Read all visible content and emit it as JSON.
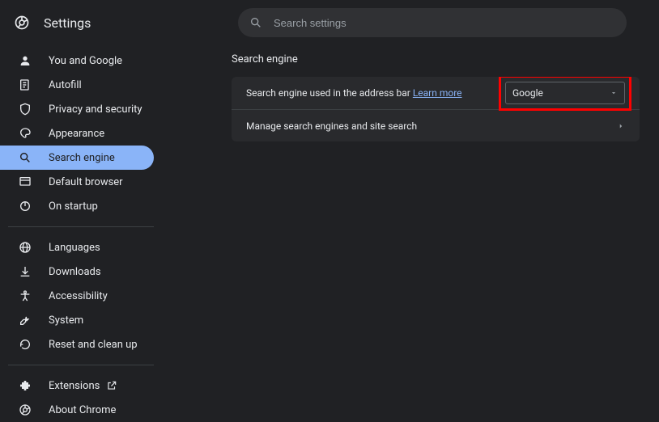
{
  "header": {
    "title": "Settings",
    "search_placeholder": "Search settings"
  },
  "sidebar": {
    "items": [
      {
        "label": "You and Google",
        "icon": "user-icon"
      },
      {
        "label": "Autofill",
        "icon": "autofill-icon"
      },
      {
        "label": "Privacy and security",
        "icon": "shield-icon"
      },
      {
        "label": "Appearance",
        "icon": "appearance-icon"
      },
      {
        "label": "Search engine",
        "icon": "search-icon",
        "active": true
      },
      {
        "label": "Default browser",
        "icon": "browser-icon"
      },
      {
        "label": "On startup",
        "icon": "power-icon"
      }
    ],
    "items2": [
      {
        "label": "Languages",
        "icon": "globe-icon"
      },
      {
        "label": "Downloads",
        "icon": "download-icon"
      },
      {
        "label": "Accessibility",
        "icon": "accessibility-icon"
      },
      {
        "label": "System",
        "icon": "wrench-icon"
      },
      {
        "label": "Reset and clean up",
        "icon": "reset-icon"
      }
    ],
    "items3": [
      {
        "label": "Extensions",
        "icon": "extension-icon",
        "external": true
      },
      {
        "label": "About Chrome",
        "icon": "chrome-icon"
      }
    ]
  },
  "main": {
    "section_title": "Search engine",
    "row1_text": "Search engine used in the address bar ",
    "row1_link": "Learn more",
    "dropdown_value": "Google",
    "row2_text": "Manage search engines and site search"
  }
}
